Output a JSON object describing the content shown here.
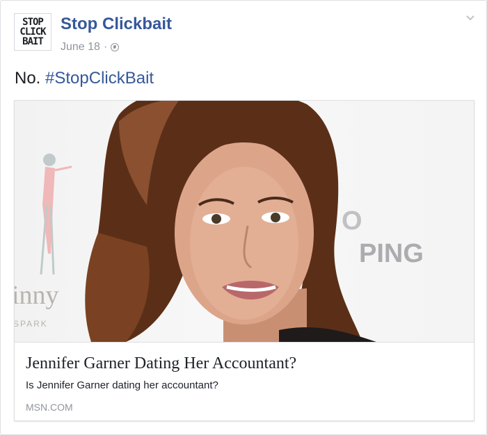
{
  "post": {
    "page_name": "Stop Clickbait",
    "avatar_text": "STOP\nCLICK\nBAIT",
    "date": "June 18",
    "separator": "·",
    "privacy_icon": "globe-icon",
    "menu_icon": "chevron-down-icon",
    "message_text": "No.",
    "hashtag": "#StopClickBait"
  },
  "link": {
    "title": "Jennifer Garner Dating Her Accountant?",
    "description": "Is Jennifer Garner dating her accountant?",
    "domain": "MSN.COM",
    "backdrop_text_left": "inny",
    "backdrop_text_left_small": "SPARK",
    "backdrop_text_right": "PING"
  },
  "colors": {
    "link_blue": "#365899",
    "meta_gray": "#90949c",
    "text_dark": "#1c1e21",
    "border": "#dddfe2"
  }
}
